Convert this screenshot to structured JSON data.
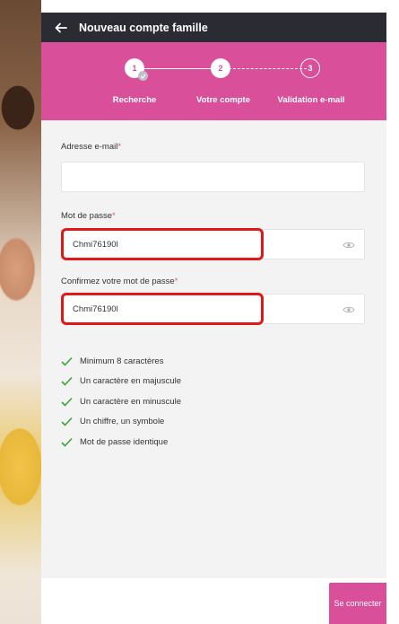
{
  "header": {
    "title": "Nouveau compte famille"
  },
  "stepper": {
    "steps": [
      {
        "number": "1",
        "label": "Recherche",
        "state": "done"
      },
      {
        "number": "2",
        "label": "Votre compte",
        "state": "current"
      },
      {
        "number": "3",
        "label": "Validation e-mail",
        "state": "upcoming"
      }
    ]
  },
  "form": {
    "email": {
      "label": "Adresse e-mail",
      "required_mark": "*",
      "value": ""
    },
    "password": {
      "label": "Mot de passe",
      "required_mark": "*",
      "value": "Chmi76190l"
    },
    "confirm": {
      "label": "Confirmez votre mot de passe",
      "required_mark": "*",
      "value": "Chmi76190l"
    }
  },
  "rules": [
    "Minimum 8 caractères",
    "Un caractère en majuscule",
    "Un caractère en minuscule",
    "Un chiffre, un symbole",
    "Mot de passe identique"
  ],
  "footer": {
    "login_label": "Se connecter"
  },
  "colors": {
    "brand": "#d94f9a",
    "topbar": "#2b2b33",
    "valid": "#3aa63a",
    "highlight": "#e01818"
  }
}
